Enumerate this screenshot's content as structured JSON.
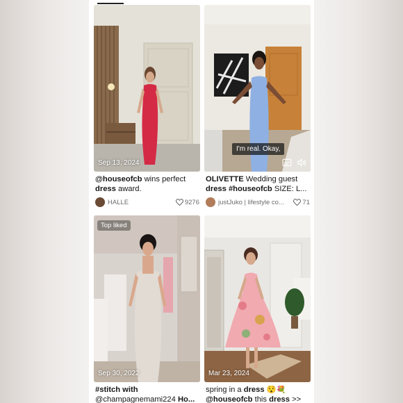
{
  "posts": [
    {
      "date": "Sep 13, 2024",
      "caption_line1": [
        "@houseofcb",
        " wins perfect"
      ],
      "caption_line2": [
        "dress",
        " award."
      ],
      "author": "HALLE",
      "likes": "9276",
      "colors": {
        "dress": "#d42a45",
        "wall": "#e4e1d8"
      }
    },
    {
      "date": "",
      "caption_line1": [
        "OLIVETTE",
        " Wedding guest"
      ],
      "caption_line2": [
        "dress #houseofcb",
        " SIZE: L..."
      ],
      "author": "justJuko | lifestyle co...",
      "likes": "71",
      "subtitle": "I'm real. Okay,",
      "colors": {
        "dress": "#8fb0e2",
        "wall": "#ece9e2"
      }
    },
    {
      "date": "Sep 30, 2022",
      "badge": "Top liked",
      "caption_line1": [
        "#stitch with",
        ""
      ],
      "caption_line2": [
        "@champagnemami224 ",
        "Ho..."
      ],
      "colors": {
        "dress": "#e2dbd3",
        "wall": "#d9d3ce"
      }
    },
    {
      "date": "Mar 23, 2024",
      "caption_line1": [
        "spring in a ",
        "dress",
        " 😯💐"
      ],
      "caption_line2": [
        "@houseofcb",
        " this ",
        "dress",
        " >>"
      ],
      "colors": {
        "dress": "#f0aab0",
        "wall": "#e9e7e3"
      }
    }
  ],
  "icons": [
    "captions-icon",
    "volume-icon",
    "heart-icon"
  ]
}
